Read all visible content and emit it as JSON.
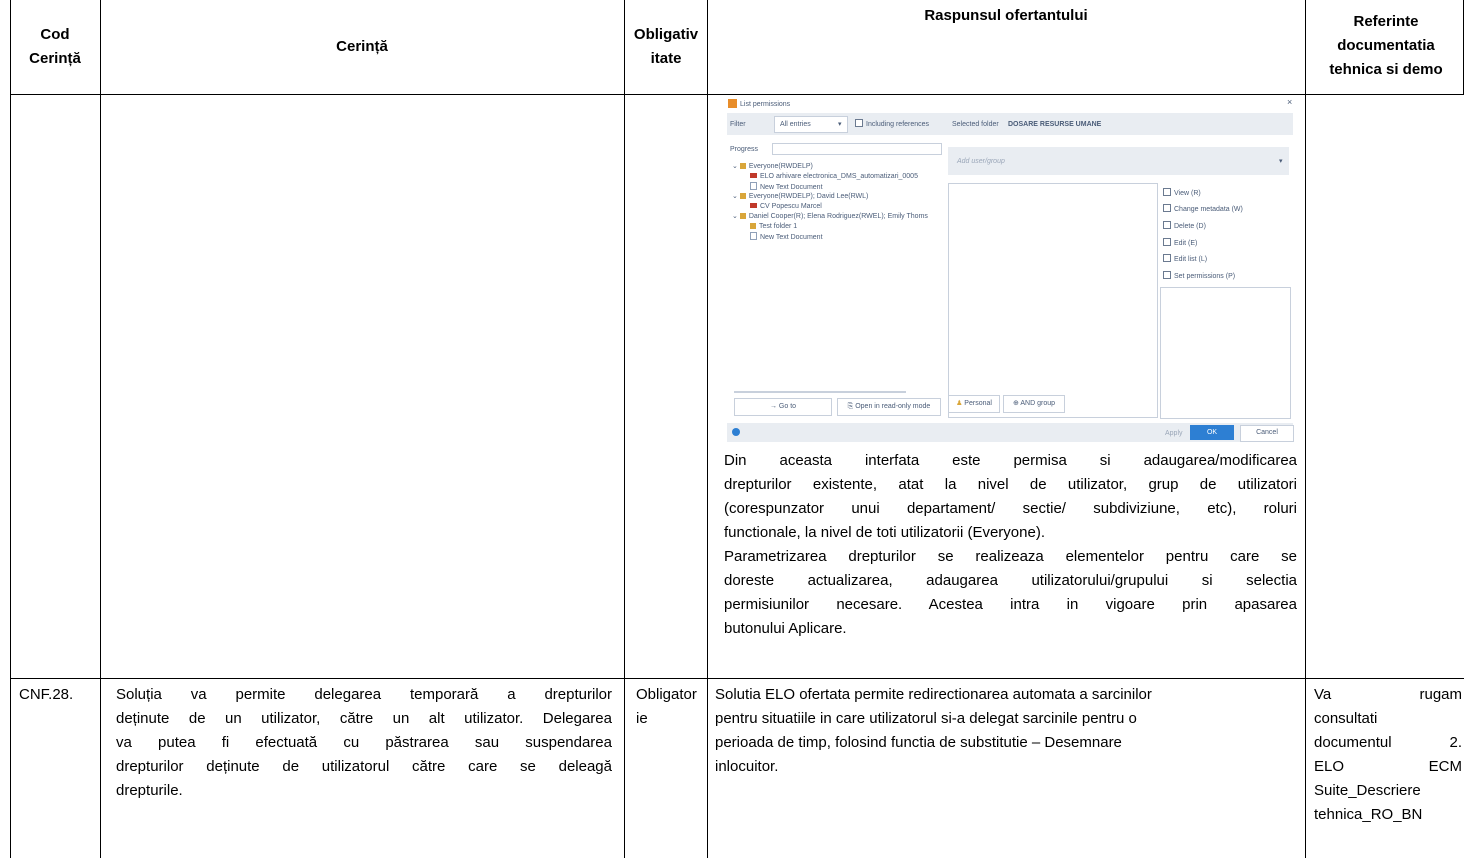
{
  "header": {
    "code": "Cod Cerință",
    "requirement": "Cerință",
    "mandatory": "Obligativ itate",
    "response": "Raspunsul ofertantului",
    "references": "Referinte documentatia tehnica si demo"
  },
  "dialog": {
    "title": "List permissions",
    "filter_label": "Filter",
    "filter_value": "All entries",
    "including_references": "Including references",
    "selected_folder_prefix": "Selected folder",
    "selected_folder": "DOSARE RESURSE UMANE",
    "progress_label": "Progress",
    "add_user_placeholder": "Add user/group",
    "tree": [
      {
        "text": "Everyone(RWDELP)",
        "icon": "group-icon",
        "level": 0
      },
      {
        "text": "ELO arhivare electronica_DMS_automatizari_0005",
        "icon": "elo-doc-icon",
        "level": 1
      },
      {
        "text": "New Text Document",
        "icon": "document-icon",
        "level": 1
      },
      {
        "text": "Everyone(RWDELP); David Lee(RWL)",
        "icon": "group-icon",
        "level": 0
      },
      {
        "text": "CV Popescu Marcel",
        "icon": "elo-doc-icon",
        "level": 1
      },
      {
        "text": "Daniel Cooper(R); Elena Rodriguez(RWEL); Emily Thoms",
        "icon": "group-icon",
        "level": 0
      },
      {
        "text": "Test folder 1",
        "icon": "folder-icon",
        "level": 1
      },
      {
        "text": "New Text Document",
        "icon": "document-icon",
        "level": 1
      }
    ],
    "permissions": [
      "View (R)",
      "Change metadata (W)",
      "Delete (D)",
      "Edit (E)",
      "Edit list (L)",
      "Set permissions (P)"
    ],
    "goto_button": "Go to",
    "readonly_button": "Open in read-only mode",
    "personal_button": "Personal",
    "and_group_button": "AND group",
    "apply_button": "Apply",
    "ok_button": "OK",
    "cancel_button": "Cancel"
  },
  "row1": {
    "response_lines": [
      "Din aceasta interfata este permisa si adaugarea/modificarea",
      "drepturilor existente, atat la nivel de utilizator, grup de utilizatori",
      "(corespunzator unui departament/ sectie/ subdiviziune, etc), roluri",
      "functionale, la nivel de toti utilizatorii (Everyone).",
      "Parametrizarea drepturilor se realizeaza elementelor pentru care se",
      "doreste actualizarea, adaugarea utilizatorului/grupului si selectia",
      "permisiunilor necesare. Acestea intra in vigoare prin apasarea",
      "butonului Aplicare."
    ]
  },
  "row2": {
    "code": "CNF.28.",
    "requirement_lines": [
      "Soluția va permite delegarea temporară a drepturilor",
      "deținute de un utilizator, către un alt utilizator. Delegarea",
      "va putea fi efectuată cu păstrarea sau suspendarea",
      "drepturilor deținute de utilizatorul către care se deleagă",
      "drepturile."
    ],
    "mandatory_lines": [
      "Obligator",
      "ie"
    ],
    "response_lines": [
      "Solutia ELO ofertata permite redirectionarea automata a sarcinilor",
      "pentru situatiile in care utilizatorul si-a delegat sarcinile pentru o",
      "perioada de timp, folosind functia de substitutie – Desemnare",
      "inlocuitor."
    ],
    "reference_lines": [
      "Va rugam",
      "consultati",
      "documentul 2.",
      "ELO ECM",
      "Suite_Descriere",
      "tehnica_RO_BN"
    ]
  },
  "colors": {
    "dialog_bar": "#e9edf2",
    "ok_blue": "#2d7fd3",
    "elo_red": "#c0392b",
    "folder_gold": "#d9a63a"
  }
}
